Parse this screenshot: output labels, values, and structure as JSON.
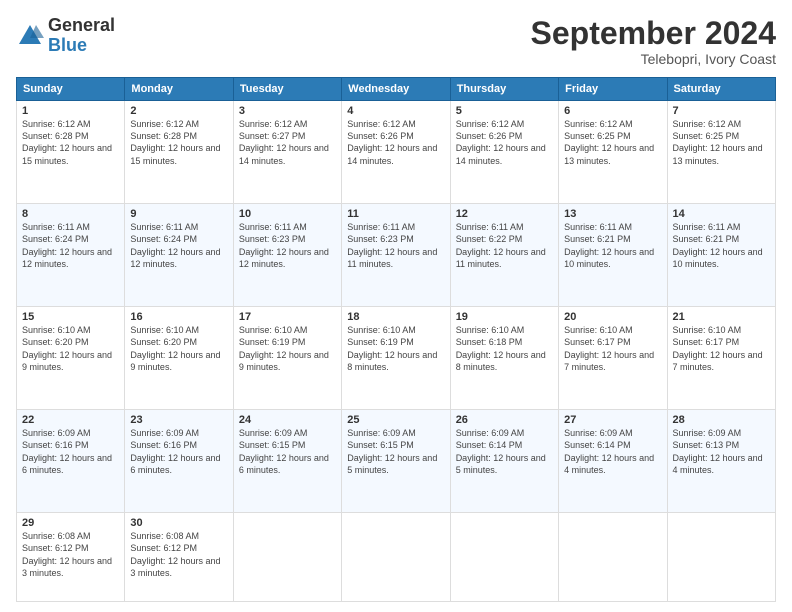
{
  "header": {
    "logo_general": "General",
    "logo_blue": "Blue",
    "month_title": "September 2024",
    "location": "Telebopri, Ivory Coast"
  },
  "days_of_week": [
    "Sunday",
    "Monday",
    "Tuesday",
    "Wednesday",
    "Thursday",
    "Friday",
    "Saturday"
  ],
  "weeks": [
    [
      {
        "day": 1,
        "sunrise": "6:12 AM",
        "sunset": "6:28 PM",
        "daylight": "12 hours and 15 minutes."
      },
      {
        "day": 2,
        "sunrise": "6:12 AM",
        "sunset": "6:28 PM",
        "daylight": "12 hours and 15 minutes."
      },
      {
        "day": 3,
        "sunrise": "6:12 AM",
        "sunset": "6:27 PM",
        "daylight": "12 hours and 14 minutes."
      },
      {
        "day": 4,
        "sunrise": "6:12 AM",
        "sunset": "6:26 PM",
        "daylight": "12 hours and 14 minutes."
      },
      {
        "day": 5,
        "sunrise": "6:12 AM",
        "sunset": "6:26 PM",
        "daylight": "12 hours and 14 minutes."
      },
      {
        "day": 6,
        "sunrise": "6:12 AM",
        "sunset": "6:25 PM",
        "daylight": "12 hours and 13 minutes."
      },
      {
        "day": 7,
        "sunrise": "6:12 AM",
        "sunset": "6:25 PM",
        "daylight": "12 hours and 13 minutes."
      }
    ],
    [
      {
        "day": 8,
        "sunrise": "6:11 AM",
        "sunset": "6:24 PM",
        "daylight": "12 hours and 12 minutes."
      },
      {
        "day": 9,
        "sunrise": "6:11 AM",
        "sunset": "6:24 PM",
        "daylight": "12 hours and 12 minutes."
      },
      {
        "day": 10,
        "sunrise": "6:11 AM",
        "sunset": "6:23 PM",
        "daylight": "12 hours and 12 minutes."
      },
      {
        "day": 11,
        "sunrise": "6:11 AM",
        "sunset": "6:23 PM",
        "daylight": "12 hours and 11 minutes."
      },
      {
        "day": 12,
        "sunrise": "6:11 AM",
        "sunset": "6:22 PM",
        "daylight": "12 hours and 11 minutes."
      },
      {
        "day": 13,
        "sunrise": "6:11 AM",
        "sunset": "6:21 PM",
        "daylight": "12 hours and 10 minutes."
      },
      {
        "day": 14,
        "sunrise": "6:11 AM",
        "sunset": "6:21 PM",
        "daylight": "12 hours and 10 minutes."
      }
    ],
    [
      {
        "day": 15,
        "sunrise": "6:10 AM",
        "sunset": "6:20 PM",
        "daylight": "12 hours and 9 minutes."
      },
      {
        "day": 16,
        "sunrise": "6:10 AM",
        "sunset": "6:20 PM",
        "daylight": "12 hours and 9 minutes."
      },
      {
        "day": 17,
        "sunrise": "6:10 AM",
        "sunset": "6:19 PM",
        "daylight": "12 hours and 9 minutes."
      },
      {
        "day": 18,
        "sunrise": "6:10 AM",
        "sunset": "6:19 PM",
        "daylight": "12 hours and 8 minutes."
      },
      {
        "day": 19,
        "sunrise": "6:10 AM",
        "sunset": "6:18 PM",
        "daylight": "12 hours and 8 minutes."
      },
      {
        "day": 20,
        "sunrise": "6:10 AM",
        "sunset": "6:17 PM",
        "daylight": "12 hours and 7 minutes."
      },
      {
        "day": 21,
        "sunrise": "6:10 AM",
        "sunset": "6:17 PM",
        "daylight": "12 hours and 7 minutes."
      }
    ],
    [
      {
        "day": 22,
        "sunrise": "6:09 AM",
        "sunset": "6:16 PM",
        "daylight": "12 hours and 6 minutes."
      },
      {
        "day": 23,
        "sunrise": "6:09 AM",
        "sunset": "6:16 PM",
        "daylight": "12 hours and 6 minutes."
      },
      {
        "day": 24,
        "sunrise": "6:09 AM",
        "sunset": "6:15 PM",
        "daylight": "12 hours and 6 minutes."
      },
      {
        "day": 25,
        "sunrise": "6:09 AM",
        "sunset": "6:15 PM",
        "daylight": "12 hours and 5 minutes."
      },
      {
        "day": 26,
        "sunrise": "6:09 AM",
        "sunset": "6:14 PM",
        "daylight": "12 hours and 5 minutes."
      },
      {
        "day": 27,
        "sunrise": "6:09 AM",
        "sunset": "6:14 PM",
        "daylight": "12 hours and 4 minutes."
      },
      {
        "day": 28,
        "sunrise": "6:09 AM",
        "sunset": "6:13 PM",
        "daylight": "12 hours and 4 minutes."
      }
    ],
    [
      {
        "day": 29,
        "sunrise": "6:08 AM",
        "sunset": "6:12 PM",
        "daylight": "12 hours and 3 minutes."
      },
      {
        "day": 30,
        "sunrise": "6:08 AM",
        "sunset": "6:12 PM",
        "daylight": "12 hours and 3 minutes."
      },
      null,
      null,
      null,
      null,
      null
    ]
  ]
}
